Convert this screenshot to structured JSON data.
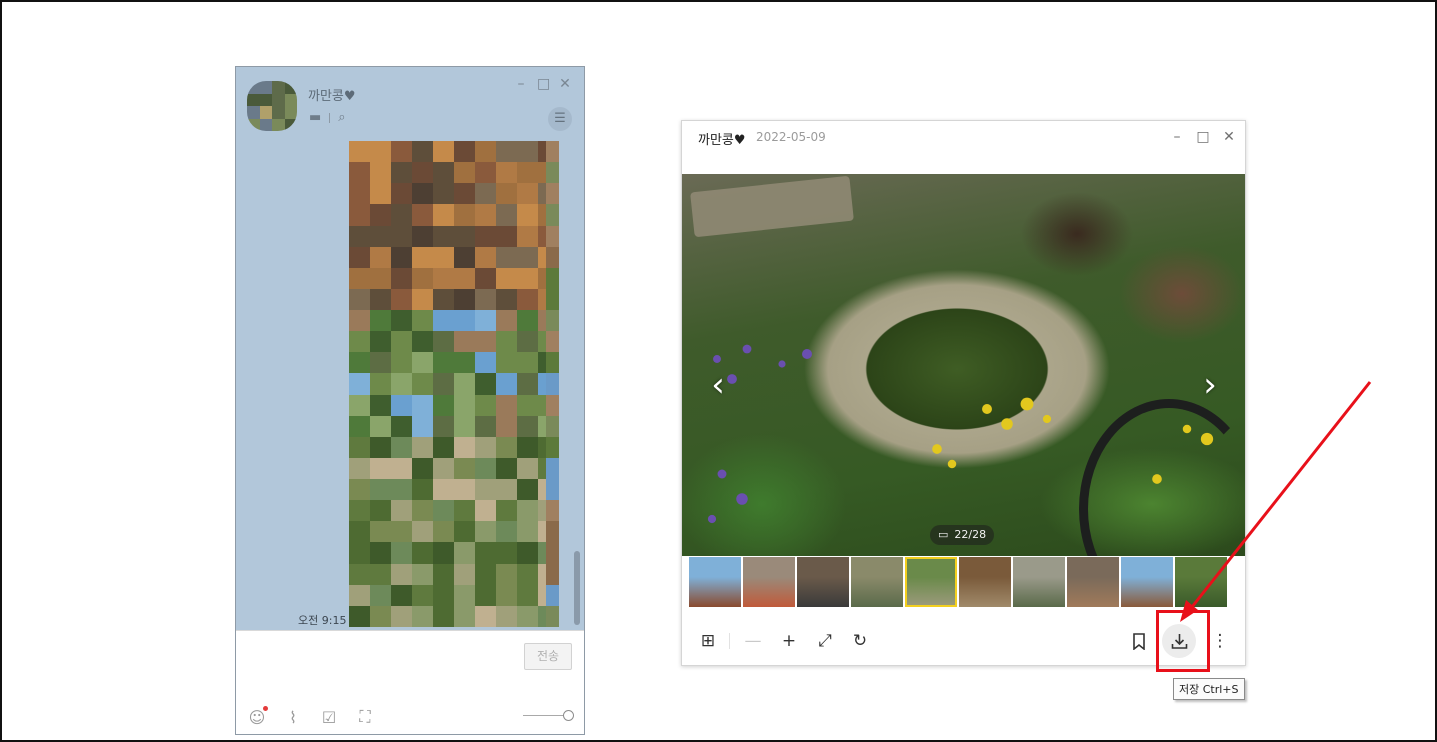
{
  "chat_window": {
    "title": "까만콩♥",
    "time": "오전 9:15",
    "send_label": "전송",
    "window_controls": [
      "minimize-icon",
      "maximize-icon",
      "close-icon"
    ],
    "header_tools": [
      "drawer-icon",
      "search-icon"
    ],
    "menu_icon": "hamburger-menu-icon",
    "bottom_tools": [
      "emoticon-icon",
      "attach-file-icon",
      "schedule-icon",
      "screen-capture-icon"
    ],
    "colors": {
      "background": "#b2c7da",
      "input_background": "#ffffff"
    }
  },
  "photo_viewer": {
    "title": "까만콩♥",
    "date": "2022-05-09",
    "counter": "22/28",
    "window_controls": [
      "minimize-icon",
      "maximize-icon",
      "close-icon"
    ],
    "nav": {
      "prev": "chevron-left-icon",
      "next": "chevron-right-icon"
    },
    "thumbnails": {
      "visible_count": 10,
      "selected_index": 4
    },
    "toolbar": [
      {
        "name": "grid-view",
        "icon": "grid-icon",
        "enabled": true
      },
      {
        "name": "zoom-out",
        "icon": "minus-icon",
        "enabled": false
      },
      {
        "name": "zoom-in",
        "icon": "plus-icon",
        "enabled": true
      },
      {
        "name": "expand",
        "icon": "expand-icon",
        "enabled": true
      },
      {
        "name": "rotate",
        "icon": "rotate-icon",
        "enabled": true
      },
      {
        "name": "bookmark",
        "icon": "bookmark-icon",
        "enabled": true
      },
      {
        "name": "save",
        "icon": "download-icon",
        "enabled": true
      },
      {
        "name": "more",
        "icon": "more-vertical-icon",
        "enabled": true
      }
    ],
    "tooltip": "저장 Ctrl+S"
  },
  "annotation": {
    "color": "#e8101a"
  }
}
